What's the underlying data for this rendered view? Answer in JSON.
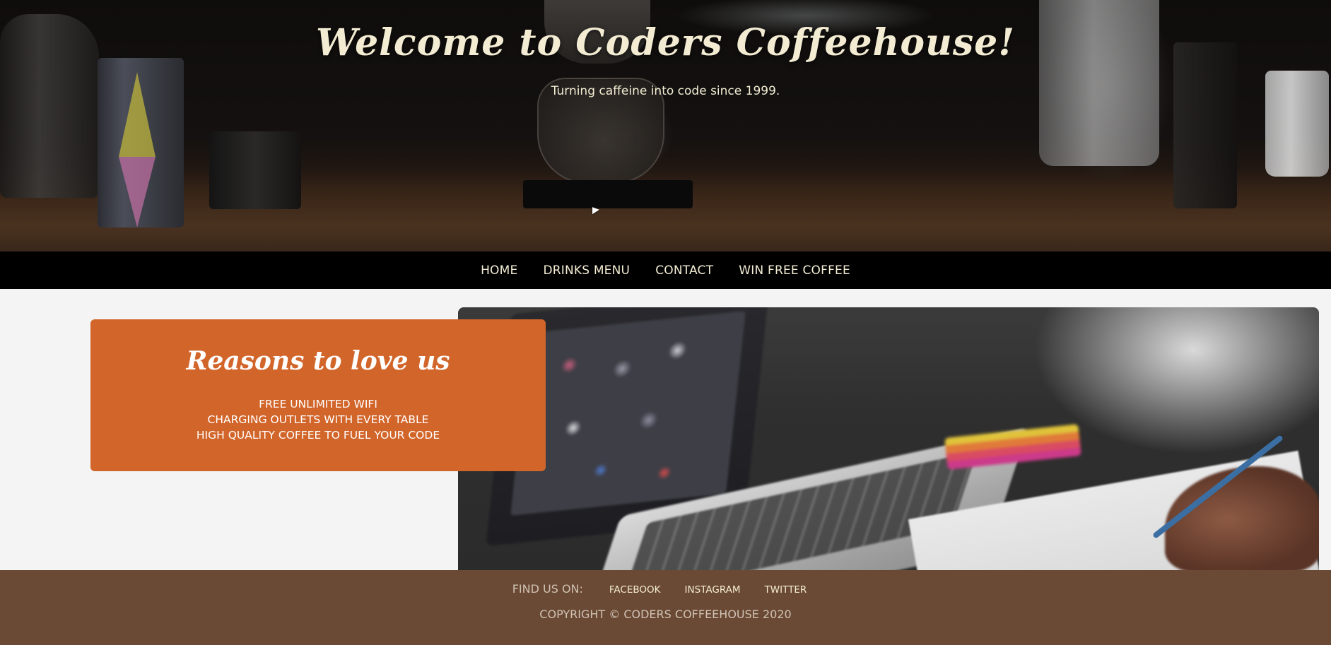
{
  "hero": {
    "title": "Welcome to Coders Coffeehouse!",
    "subtitle": "Turning caffeine into code since 1999."
  },
  "nav": {
    "items": [
      {
        "label": "HOME"
      },
      {
        "label": "DRINKS MENU"
      },
      {
        "label": "CONTACT"
      },
      {
        "label": "WIN FREE COFFEE"
      }
    ]
  },
  "reasons": {
    "heading": "Reasons to love us",
    "items": [
      "FREE UNLIMITED WIFI",
      "CHARGING OUTLETS WITH EVERY TABLE",
      "HIGH QUALITY COFFEE TO FUEL YOUR CODE"
    ]
  },
  "footer": {
    "find_label": "FIND US ON:",
    "social": [
      {
        "label": "FACEBOOK"
      },
      {
        "label": "INSTAGRAM"
      },
      {
        "label": "TWITTER"
      }
    ],
    "copyright": "COPYRIGHT © CODERS COFFEEHOUSE 2020"
  },
  "colors": {
    "accent_orange": "#d2652a",
    "nav_background": "#000000",
    "footer_background": "#6b4a35",
    "cream_text": "#f3ecd3",
    "page_background": "#f4f4f4"
  },
  "images": {
    "hero_background": "coffee-bar-photo",
    "feature_photo": "laptop-and-notebook-photo"
  }
}
